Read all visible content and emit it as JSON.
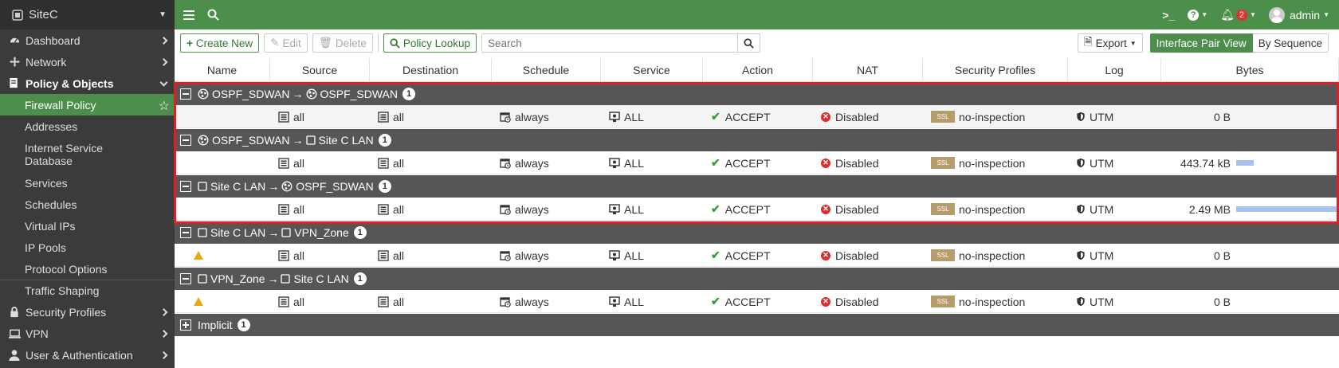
{
  "sidebar": {
    "site": "SiteC",
    "items": [
      {
        "label": "Dashboard",
        "icon": "dashboard-icon"
      },
      {
        "label": "Network",
        "icon": "network-icon"
      },
      {
        "label": "Policy & Objects",
        "icon": "policy-icon"
      }
    ],
    "sub_items": [
      "Firewall Policy",
      "Addresses",
      "Internet Service Database",
      "Services",
      "Schedules",
      "Virtual IPs",
      "IP Pools",
      "Protocol Options",
      "Traffic Shaping"
    ],
    "bottom_items": [
      {
        "label": "Security Profiles",
        "icon": "lock-icon"
      },
      {
        "label": "VPN",
        "icon": "laptop-icon"
      },
      {
        "label": "User & Authentication",
        "icon": "user-icon"
      }
    ]
  },
  "topbar": {
    "notifications": "2",
    "user": "admin"
  },
  "toolbar": {
    "create_new": "Create New",
    "edit": "Edit",
    "delete": "Delete",
    "policy_lookup": "Policy Lookup",
    "search_placeholder": "Search",
    "export": "Export",
    "interface_pair_view": "Interface Pair View",
    "by_sequence": "By Sequence"
  },
  "table": {
    "columns": [
      "Name",
      "Source",
      "Destination",
      "Schedule",
      "Service",
      "Action",
      "NAT",
      "Security Profiles",
      "Log",
      "Bytes"
    ],
    "groups": [
      {
        "from": "OSPF_SDWAN",
        "to": "OSPF_SDWAN",
        "count": "1",
        "from_zone": true,
        "to_zone": true,
        "row": {
          "name_warn": false,
          "source": "all",
          "destination": "all",
          "schedule": "always",
          "service": "ALL",
          "action": "ACCEPT",
          "nat": "Disabled",
          "profile": "no-inspection",
          "log": "UTM",
          "bytes": "0 B",
          "bar": 0
        }
      },
      {
        "from": "OSPF_SDWAN",
        "to": "Site C LAN",
        "count": "1",
        "from_zone": true,
        "to_zone": false,
        "row": {
          "name_warn": false,
          "source": "all",
          "destination": "all",
          "schedule": "always",
          "service": "ALL",
          "action": "ACCEPT",
          "nat": "Disabled",
          "profile": "no-inspection",
          "log": "UTM",
          "bytes": "443.74 kB",
          "bar": 0.17
        }
      },
      {
        "from": "Site C LAN",
        "to": "OSPF_SDWAN",
        "count": "1",
        "from_zone": false,
        "to_zone": true,
        "row": {
          "name_warn": false,
          "source": "all",
          "destination": "all",
          "schedule": "always",
          "service": "ALL",
          "action": "ACCEPT",
          "nat": "Disabled",
          "profile": "no-inspection",
          "log": "UTM",
          "bytes": "2.49 MB",
          "bar": 1
        }
      },
      {
        "from": "Site C LAN",
        "to": "VPN_Zone",
        "count": "1",
        "from_zone": false,
        "to_zone": false,
        "row": {
          "name_warn": true,
          "source": "all",
          "destination": "all",
          "schedule": "always",
          "service": "ALL",
          "action": "ACCEPT",
          "nat": "Disabled",
          "profile": "no-inspection",
          "log": "UTM",
          "bytes": "0 B",
          "bar": 0
        }
      },
      {
        "from": "VPN_Zone",
        "to": "Site C LAN",
        "count": "1",
        "from_zone": false,
        "to_zone": false,
        "row": {
          "name_warn": true,
          "source": "all",
          "destination": "all",
          "schedule": "always",
          "service": "ALL",
          "action": "ACCEPT",
          "nat": "Disabled",
          "profile": "no-inspection",
          "log": "UTM",
          "bytes": "0 B",
          "bar": 0
        }
      }
    ],
    "implicit": {
      "label": "Implicit",
      "count": "1"
    },
    "ssl_tag": "SSL"
  },
  "colors": {
    "accent": "#4b8f4b",
    "highlight": "#e01e25",
    "group_bg": "#565656"
  }
}
